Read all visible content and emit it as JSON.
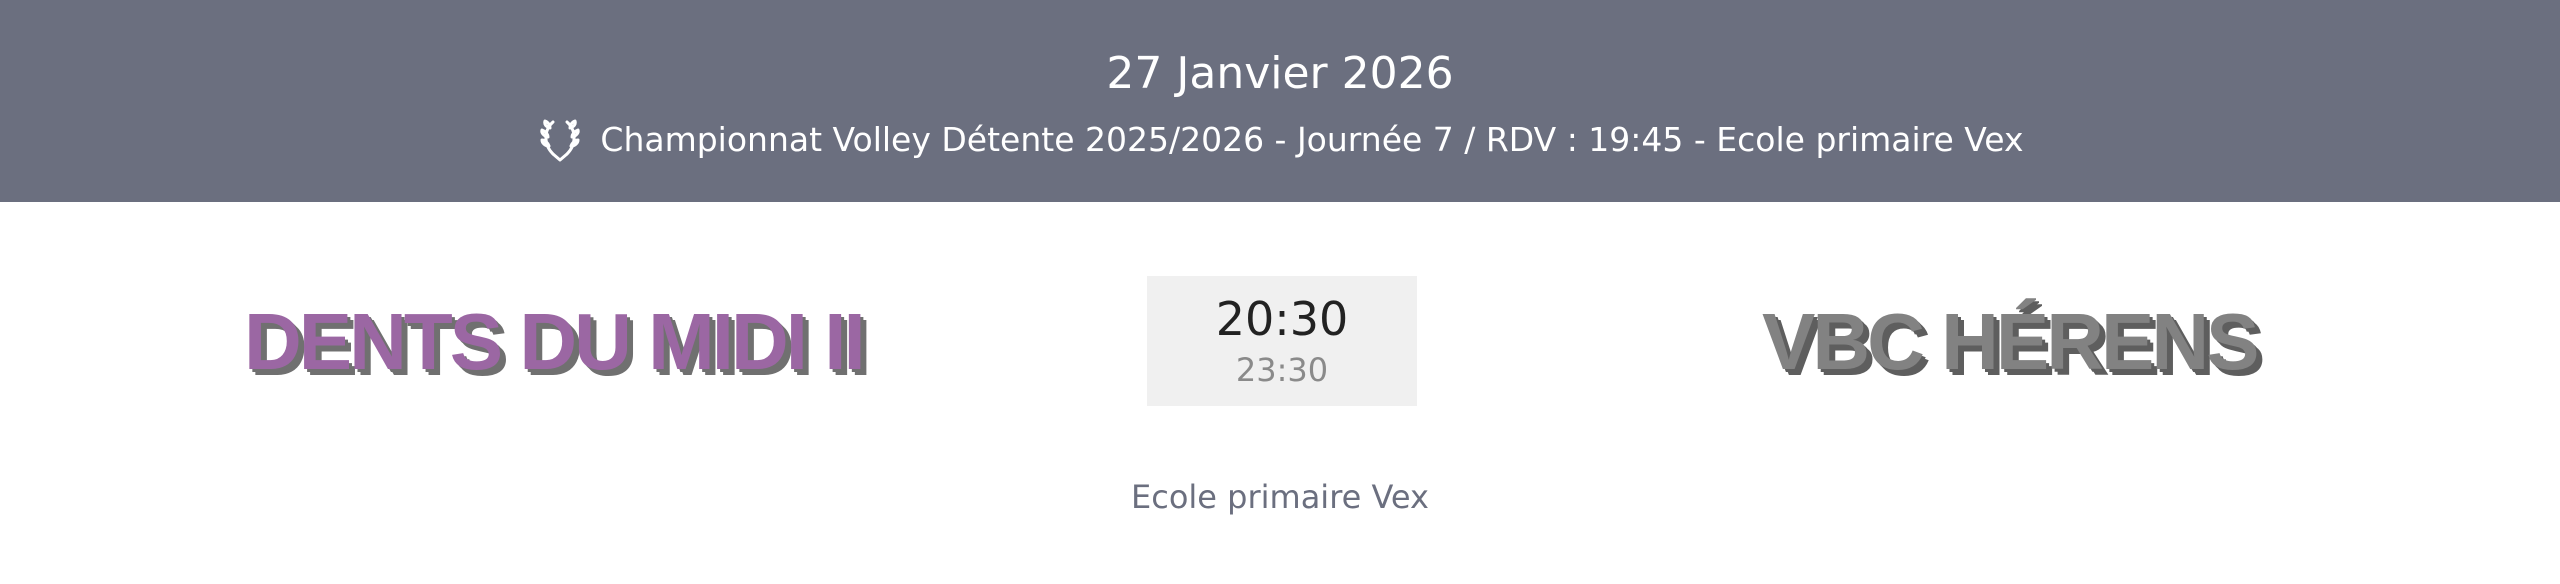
{
  "header": {
    "date": "27 Janvier 2026",
    "subtitle": "Championnat Volley Détente 2025/2026 - Journée 7 / RDV : 19:45 - Ecole primaire Vex",
    "icon": "laurel-wreath-icon",
    "background_color": "#6b6f7f"
  },
  "match": {
    "home_team": "DENTS DU MIDI II",
    "away_team": "VBC HÉRENS",
    "start_time": "20:30",
    "end_time": "23:30",
    "venue": "Ecole primaire Vex",
    "home_color": "#9b67a3",
    "away_color": "#828282"
  }
}
